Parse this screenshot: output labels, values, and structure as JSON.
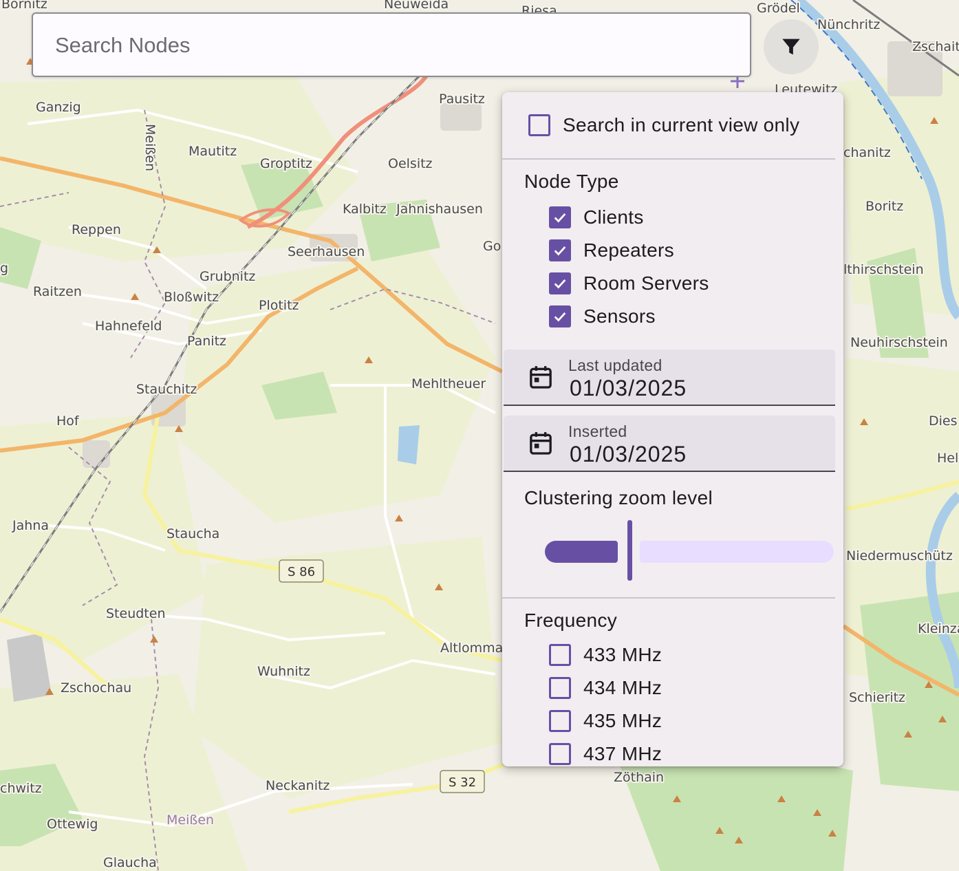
{
  "search": {
    "placeholder": "Search Nodes",
    "value": ""
  },
  "filter_button": {
    "icon": "filter-icon"
  },
  "filter_panel": {
    "current_view_only": {
      "label": "Search in current view only",
      "checked": false
    },
    "node_type": {
      "title": "Node Type",
      "options": [
        {
          "label": "Clients",
          "checked": true
        },
        {
          "label": "Repeaters",
          "checked": true
        },
        {
          "label": "Room Servers",
          "checked": true
        },
        {
          "label": "Sensors",
          "checked": true
        }
      ]
    },
    "last_updated": {
      "label": "Last updated",
      "value": "01/03/2025",
      "icon": "calendar-icon"
    },
    "inserted": {
      "label": "Inserted",
      "value": "01/03/2025",
      "icon": "calendar-icon"
    },
    "clustering": {
      "title": "Clustering zoom level",
      "value_fraction": 0.29
    },
    "frequency": {
      "title": "Frequency",
      "options": [
        {
          "label": "433 MHz",
          "checked": false
        },
        {
          "label": "434 MHz",
          "checked": false
        },
        {
          "label": "435 MHz",
          "checked": false
        },
        {
          "label": "437 MHz",
          "checked": false
        }
      ]
    }
  },
  "map": {
    "place_labels": [
      "Bornitz",
      "Neuweida",
      "Riesa",
      "Grödel",
      "Nünchritz",
      "Zschait",
      "Ganzig",
      "Pausitz",
      "Leutewitz",
      "Meißen",
      "Mautitz",
      "Groptitz",
      "Oelsitz",
      "chanitz",
      "Kalbitz",
      "Jahnishausen",
      "Boritz",
      "Reppen",
      "Go",
      "Seerhausen",
      "lthirschstein",
      "Raitzen",
      "Grubnitz",
      "Bloßwitz",
      "Plotitz",
      "Hahnefeld",
      "Panitz",
      "Neuhirschstein",
      "Mehltheuer",
      "Stauchitz",
      "Hof",
      "Dies",
      "Hel",
      "Jahna",
      "Staucha",
      "Niedermuschütz",
      "Steudten",
      "Altlomma",
      "Kleinza",
      "Wuhnitz",
      "Zschochau",
      "Schieritz",
      "Zöthain",
      "chwitz",
      "Neckanitz",
      "Ottewig",
      "Meißen",
      "Glaucha",
      "g"
    ],
    "road_labels": [
      "S 86",
      "S 32"
    ],
    "colors": {
      "land": "#f2efe6",
      "field": "#eef0d3",
      "forest": "#c8e3b2",
      "water": "#a9cde8",
      "major_road": "#f3b56a",
      "motorway": "#f0907a",
      "railway": "#7d7d7d"
    }
  }
}
